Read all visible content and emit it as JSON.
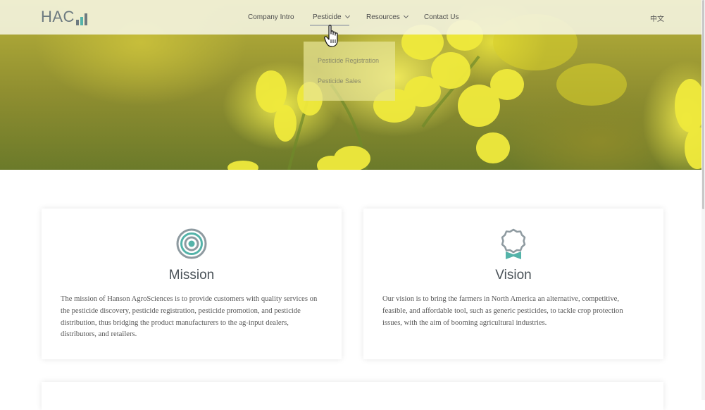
{
  "header": {
    "logo_text": "HAC",
    "nav": [
      {
        "label": "Company Intro"
      },
      {
        "label": "Pesticide"
      },
      {
        "label": "Resources"
      },
      {
        "label": "Contact Us"
      }
    ],
    "language": "中文"
  },
  "dropdown": {
    "items": [
      "Pesticide Registration",
      "Pesticide Sales"
    ]
  },
  "cards": [
    {
      "icon": "target-icon",
      "title": "Mission",
      "text": "The mission of Hanson AgroSciences is to provide customers with quality services on the pesticide discovery, pesticide registration, pesticide promotion, and pesticide distribution, thus bridging the product manufacturers to the ag-input dealers, distributors, and retailers."
    },
    {
      "icon": "award-ribbon-icon",
      "title": "Vision",
      "text": "Our vision is to bring the farmers in North America an alternative, competitive, feasible, and affordable tool, such as generic pesticides, to tackle crop protection issues, with the aim of booming agricultural industries."
    }
  ],
  "colors": {
    "accent": "#54b3a9",
    "logo": "#6d7a80",
    "hero_yellow": "#e9e64a"
  }
}
